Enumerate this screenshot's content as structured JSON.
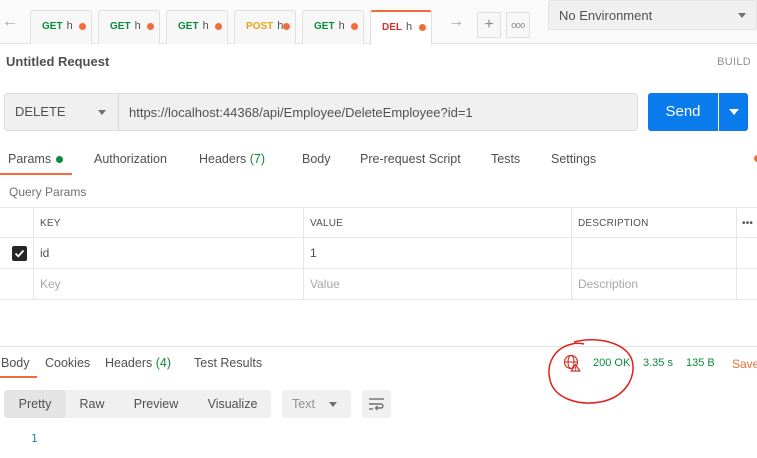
{
  "tabs": {
    "items": [
      {
        "method": "GET",
        "name": "h",
        "unsaved": true,
        "active": false
      },
      {
        "method": "GET",
        "name": "h",
        "unsaved": true,
        "active": false
      },
      {
        "method": "GET",
        "name": "h",
        "unsaved": true,
        "active": false
      },
      {
        "method": "POST",
        "name": "h",
        "unsaved": true,
        "active": false
      },
      {
        "method": "GET",
        "name": "h",
        "unsaved": true,
        "active": false
      },
      {
        "method": "DEL",
        "name": "h",
        "unsaved": true,
        "active": true
      }
    ],
    "add_symbol": "+",
    "more_symbol": "ooo",
    "back_symbol": "←",
    "forward_symbol": "→"
  },
  "environment": {
    "selected": "No Environment"
  },
  "request": {
    "title": "Untitled Request",
    "build_label": "BUILD",
    "method": "DELETE",
    "url": "https://localhost:44368/api/Employee/DeleteEmployee?id=1",
    "send_label": "Send"
  },
  "request_tabs": {
    "params": "Params",
    "authorization": "Authorization",
    "headers": "Headers",
    "headers_count": "(7)",
    "body": "Body",
    "prerequest": "Pre-request Script",
    "tests": "Tests",
    "settings": "Settings"
  },
  "query_params": {
    "section_title": "Query Params",
    "columns": {
      "key": "KEY",
      "value": "VALUE",
      "description": "DESCRIPTION"
    },
    "more_symbol": "•••",
    "rows": [
      {
        "checked": true,
        "key": "id",
        "value": "1",
        "description": ""
      }
    ],
    "placeholder": {
      "key": "Key",
      "value": "Value",
      "description": "Description"
    }
  },
  "response": {
    "tabs": {
      "body": "Body",
      "cookies": "Cookies",
      "headers": "Headers",
      "headers_count": "(4)",
      "test_results": "Test Results"
    },
    "status": "200 OK",
    "time": "3.35 s",
    "size": "135 B",
    "save_label": "Save",
    "view_modes": [
      "Pretty",
      "Raw",
      "Preview",
      "Visualize"
    ],
    "active_view": "Pretty",
    "format": "Text",
    "lines": [
      "1"
    ]
  },
  "colors": {
    "accent": "#f26b3a",
    "send": "#097bed",
    "get": "#0b8a3a",
    "post": "#e3a514",
    "delete": "#d0342c",
    "annotation": "#e0201c"
  }
}
